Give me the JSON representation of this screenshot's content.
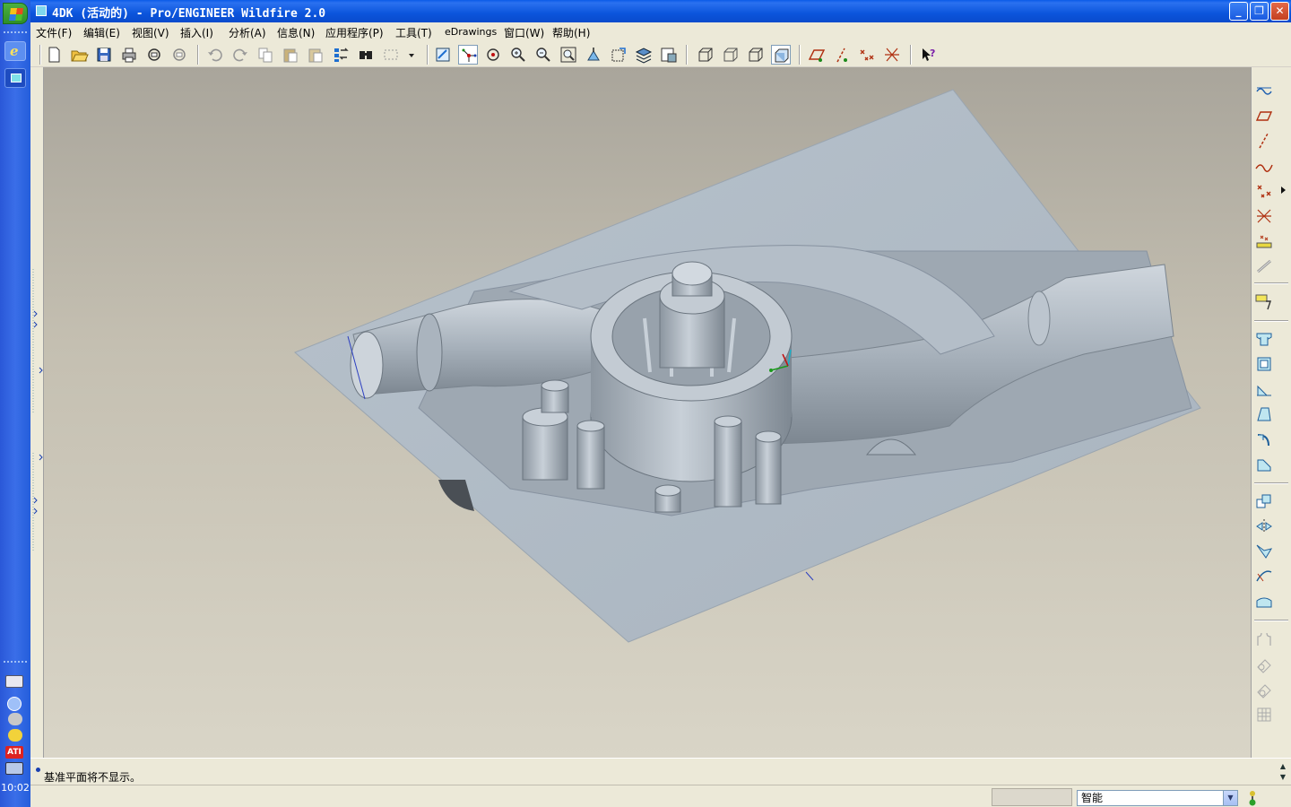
{
  "window": {
    "title": "4DK (活动的) - Pro/ENGINEER Wildfire 2.0",
    "buttons": {
      "minimize": "_",
      "maximize": "❐",
      "close": "✕"
    }
  },
  "menubar": {
    "items": [
      {
        "label": "文件(F)"
      },
      {
        "label": "编辑(E)"
      },
      {
        "label": "视图(V)"
      },
      {
        "label": "插入(I)"
      },
      {
        "label": "分析(A)"
      },
      {
        "label": "信息(N)"
      },
      {
        "label": "应用程序(P)"
      },
      {
        "label": "工具(T)"
      },
      {
        "label": "eDrawings"
      },
      {
        "label": "窗口(W)"
      },
      {
        "label": "帮助(H)"
      }
    ]
  },
  "toolbar": {
    "icons": [
      "new-icon",
      "open-icon",
      "save-icon",
      "print-icon",
      "email-icon",
      "email-link-icon",
      "undo-icon",
      "redo-icon",
      "copy-icon",
      "paste-icon",
      "paste-special-icon",
      "regenerate-icon",
      "find-icon",
      "select-box-icon",
      "repaint-icon",
      "spin-center-icon",
      "orient-mode-icon",
      "zoom-in-icon",
      "zoom-out-icon",
      "refit-icon",
      "reorient-icon",
      "saved-views-icon",
      "layers-icon",
      "view-manager-icon",
      "wireframe-icon",
      "hidden-line-icon",
      "no-hidden-icon",
      "shading-icon",
      "datum-planes-icon",
      "datum-axes-icon",
      "datum-points-icon",
      "coordinate-systems-icon",
      "whats-this-icon"
    ]
  },
  "right_toolbar": {
    "icons": [
      "sketched-curve-icon",
      "datum-plane-icon",
      "datum-axis-icon",
      "datum-curve-icon",
      "datum-point-icon",
      "offset-point-icon",
      "field-point-icon",
      "analysis-icon",
      "annotation-icon",
      "hole-icon",
      "shell-icon",
      "rib-icon",
      "draft-icon",
      "round-icon",
      "chamfer-icon",
      "copy-icon",
      "mirror-icon",
      "merge-icon",
      "trim-icon",
      "extend-icon",
      "offset-icon",
      "thicken-icon",
      "solidify-icon",
      "pattern-icon"
    ]
  },
  "message": {
    "text": "基准平面将不显示。"
  },
  "status": {
    "filter_value": "智能"
  },
  "taskbar": {
    "clock": "10:02"
  },
  "colors": {
    "model_surface": "#b8c2cc",
    "model_shadow": "#8d97a1",
    "viewport_top": "#a9a59b",
    "viewport_bottom": "#d9d5c7",
    "title_bar": "#0a55dc"
  }
}
